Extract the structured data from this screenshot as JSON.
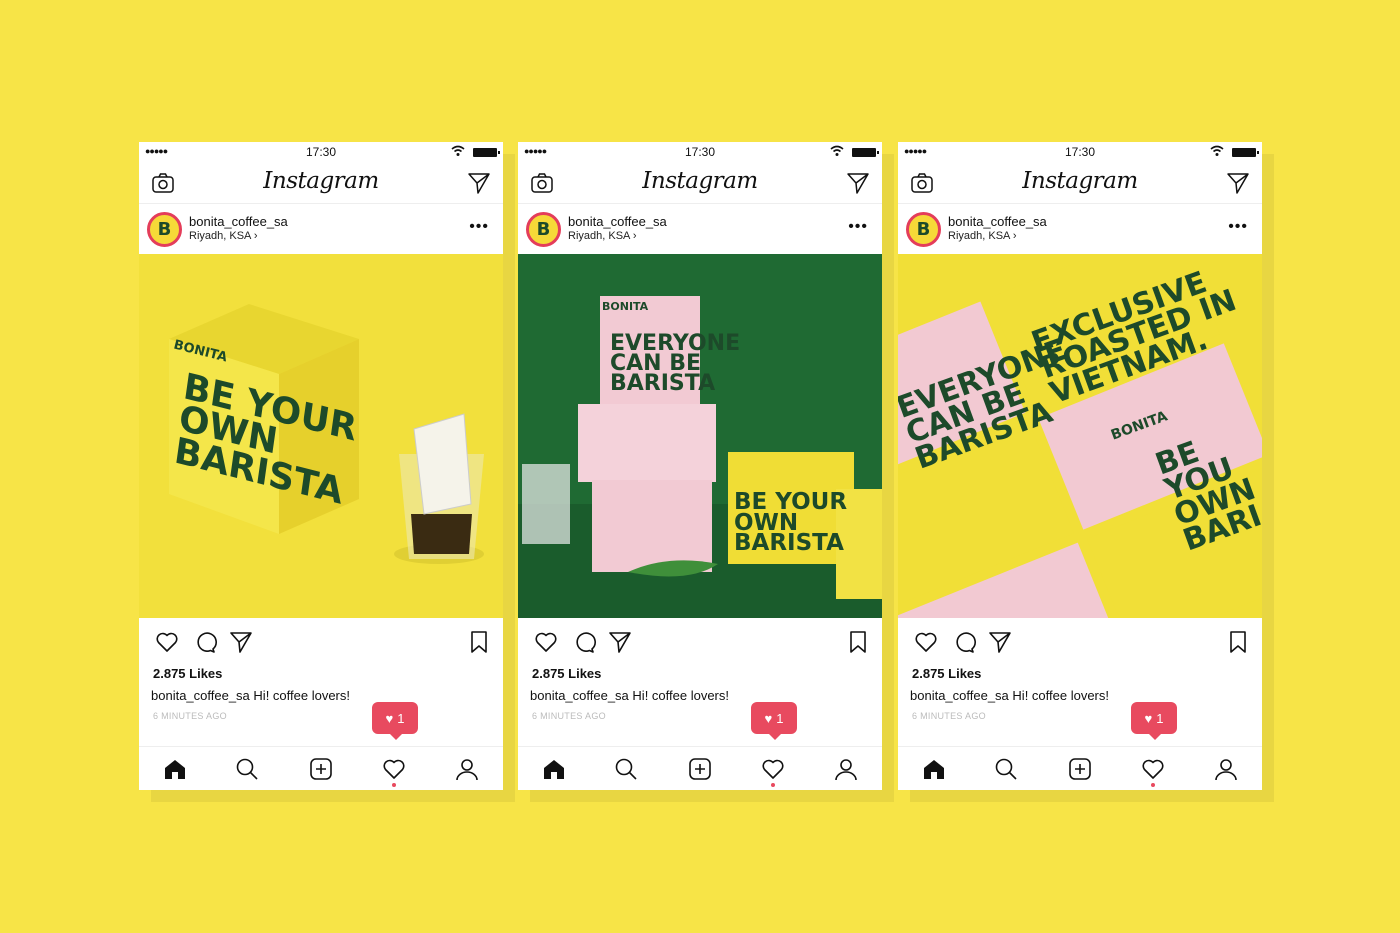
{
  "posts": [
    {
      "status_time": "17:30",
      "app_title": "Instagram",
      "username": "bonita_coffee_sa",
      "location": "Riyadh, KSA",
      "location_chevron": "›",
      "likes": "2.875 Likes",
      "caption_user": "bonita_coffee_sa",
      "caption_text": "Hi! coffee lovers!",
      "time_ago": "6 MINUTES AGO",
      "notification_count": "1",
      "photo": {
        "bg": "#f1e03a",
        "headline": [
          "BE YOUR",
          "OWN",
          "BARISTA"
        ],
        "brand": "BONITA"
      }
    },
    {
      "status_time": "17:30",
      "app_title": "Instagram",
      "username": "bonita_coffee_sa",
      "location": "Riyadh, KSA",
      "location_chevron": "›",
      "likes": "2.875 Likes",
      "caption_user": "bonita_coffee_sa",
      "caption_text": "Hi! coffee lovers!",
      "time_ago": "6 MINUTES AGO",
      "notification_count": "1",
      "photo": {
        "bg": "#1f6b34",
        "headline": [
          "EVERYONE",
          "CAN BE",
          "BARISTA"
        ],
        "headline2": [
          "BE YOUR",
          "OWN",
          "BARISTA"
        ],
        "brand": "BONITA"
      }
    },
    {
      "status_time": "17:30",
      "app_title": "Instagram",
      "username": "bonita_coffee_sa",
      "location": "Riyadh, KSA",
      "location_chevron": "›",
      "likes": "2.875 Likes",
      "caption_user": "bonita_coffee_sa",
      "caption_text": "Hi! coffee lovers!",
      "time_ago": "6 MINUTES AGO",
      "notification_count": "1",
      "photo": {
        "bg": "#f1e03a",
        "headline": [
          "EXCLUSIVE",
          "ROASTED IN",
          "VIETNAM."
        ],
        "headline2": [
          "EVERYONE",
          "CAN BE",
          "BARISTA"
        ],
        "headline3": [
          "BE YOU",
          "OWN",
          "BARI"
        ],
        "brand": "BONITA"
      }
    }
  ],
  "avatar_letter": "B",
  "signal_dots": "●●●●●",
  "more_dots": "•••",
  "heart_glyph": "♥",
  "icons": [
    "camera-icon",
    "send-icon",
    "heart-icon",
    "comment-icon",
    "bookmark-icon",
    "home-icon",
    "search-icon",
    "add-icon",
    "activity-icon",
    "profile-icon"
  ],
  "colors": {
    "background": "#f7e447",
    "brand_green": "#1d4a2a",
    "notification": "#e84a5f",
    "pink_box": "#f2c9d2"
  }
}
